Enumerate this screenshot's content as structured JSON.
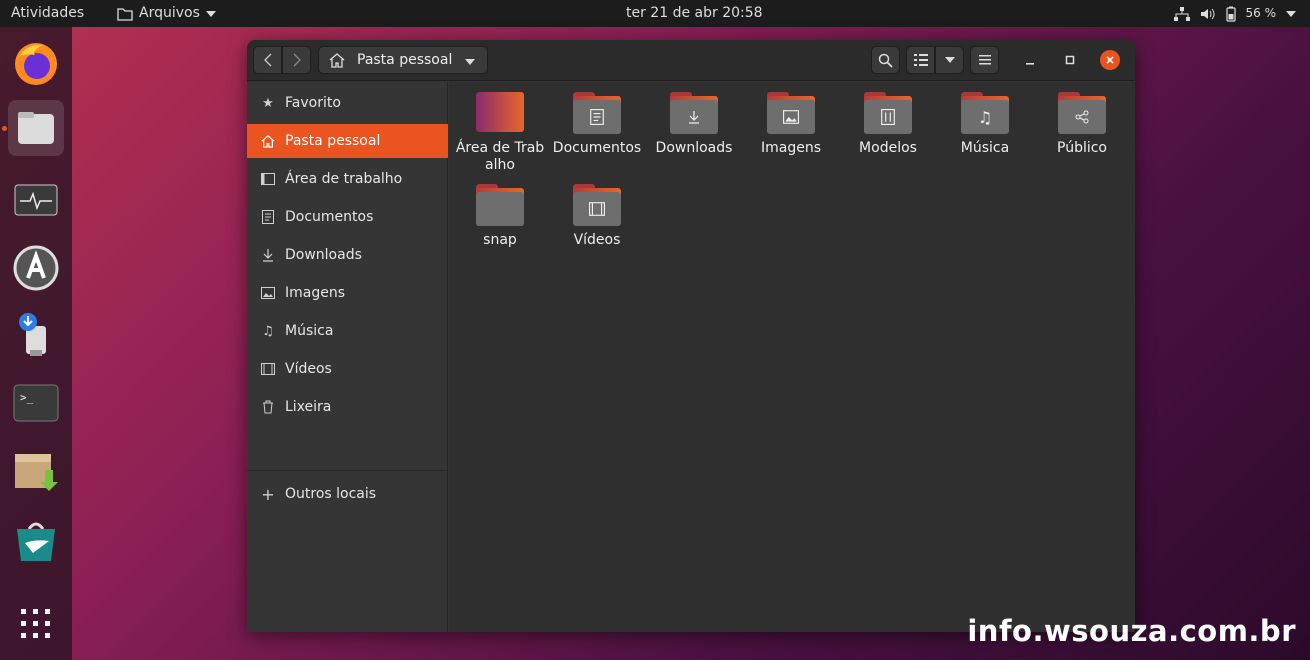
{
  "topbar": {
    "activities": "Atividades",
    "app_menu": "Arquivos",
    "clock": "ter 21 de abr  20:58",
    "battery": "56 %"
  },
  "dock": {
    "apps": [
      "firefox-icon",
      "files-icon",
      "system-monitor-icon",
      "software-center-icon",
      "usb-creator-icon",
      "terminal-icon",
      "package-installer-icon",
      "store-icon",
      "show-apps-icon"
    ]
  },
  "window": {
    "path": "Pasta pessoal",
    "sidebar": [
      {
        "label": "Favorito",
        "icon": "star-icon"
      },
      {
        "label": "Pasta pessoal",
        "icon": "home-icon",
        "selected": true
      },
      {
        "label": "Área de trabalho",
        "icon": "desktop-icon"
      },
      {
        "label": "Documentos",
        "icon": "document-icon"
      },
      {
        "label": "Downloads",
        "icon": "download-icon"
      },
      {
        "label": "Imagens",
        "icon": "image-icon"
      },
      {
        "label": "Música",
        "icon": "music-icon"
      },
      {
        "label": "Vídeos",
        "icon": "video-icon"
      },
      {
        "label": "Lixeira",
        "icon": "trash-icon"
      },
      {
        "label": "Outros locais",
        "icon": "plus-icon"
      }
    ],
    "folders": [
      {
        "label": "Área de Trabalho",
        "icon": "desktop-folder-icon"
      },
      {
        "label": "Documentos",
        "icon": "documents-folder-icon"
      },
      {
        "label": "Downloads",
        "icon": "downloads-folder-icon"
      },
      {
        "label": "Imagens",
        "icon": "images-folder-icon"
      },
      {
        "label": "Modelos",
        "icon": "templates-folder-icon"
      },
      {
        "label": "Música",
        "icon": "music-folder-icon"
      },
      {
        "label": "Público",
        "icon": "public-folder-icon"
      },
      {
        "label": "snap",
        "icon": "folder-icon"
      },
      {
        "label": "Vídeos",
        "icon": "videos-folder-icon"
      }
    ]
  },
  "watermark": "info.wsouza.com.br",
  "colors": {
    "accent": "#e95420"
  }
}
